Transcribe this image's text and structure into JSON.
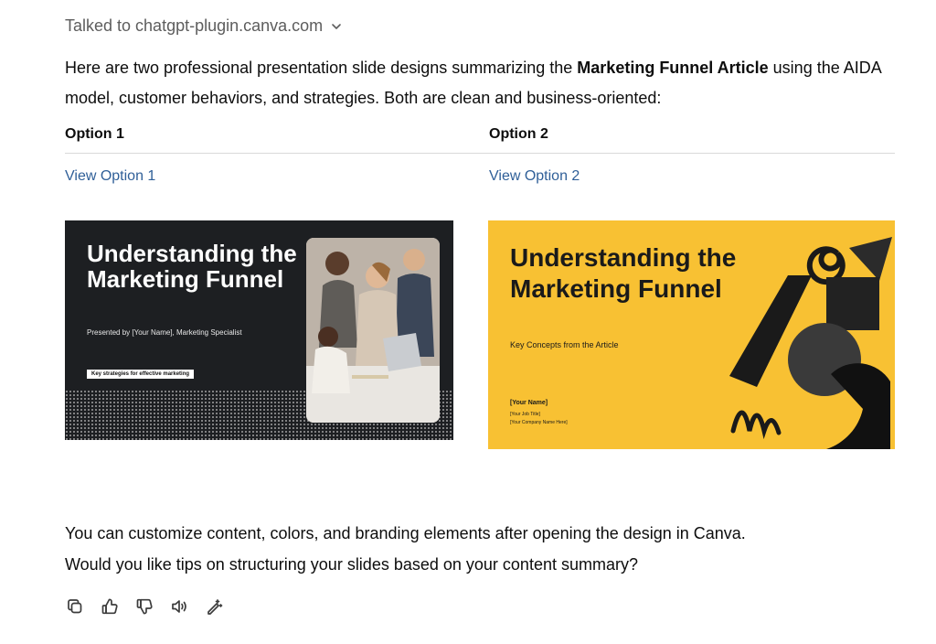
{
  "tool": {
    "label": "Talked to chatgpt-plugin.canva.com",
    "icon": "chevron-down-icon"
  },
  "intro": {
    "before": "Here are two professional presentation slide designs summarizing the ",
    "bold": "Marketing Funnel Article",
    "after": " using the AIDA model, customer behaviors, and strategies. Both are clean and business-oriented:"
  },
  "options": [
    {
      "heading": "Option 1",
      "link": "View Option 1"
    },
    {
      "heading": "Option 2",
      "link": "View Option 2"
    }
  ],
  "slide1": {
    "title": "Understanding the Marketing Funnel",
    "subtitle": "Presented by [Your Name], Marketing Specialist",
    "tag": "Key strategies for effective marketing",
    "background": "#1d1f22"
  },
  "slide2": {
    "title": "Understanding the Marketing Funnel",
    "subtitle": "Key Concepts from the Article",
    "name": "[Your Name]",
    "job": "[Your Job Title]",
    "company": "[Your Company Name Here]",
    "background": "#f8c133"
  },
  "outro": {
    "line1": "You can customize content, colors, and branding elements after opening the design in Canva.",
    "line2": "Would you like tips on structuring your slides based on your content summary?"
  },
  "actions": [
    "copy-icon",
    "thumbs-up-icon",
    "thumbs-down-icon",
    "speaker-icon",
    "edit-wand-icon"
  ]
}
